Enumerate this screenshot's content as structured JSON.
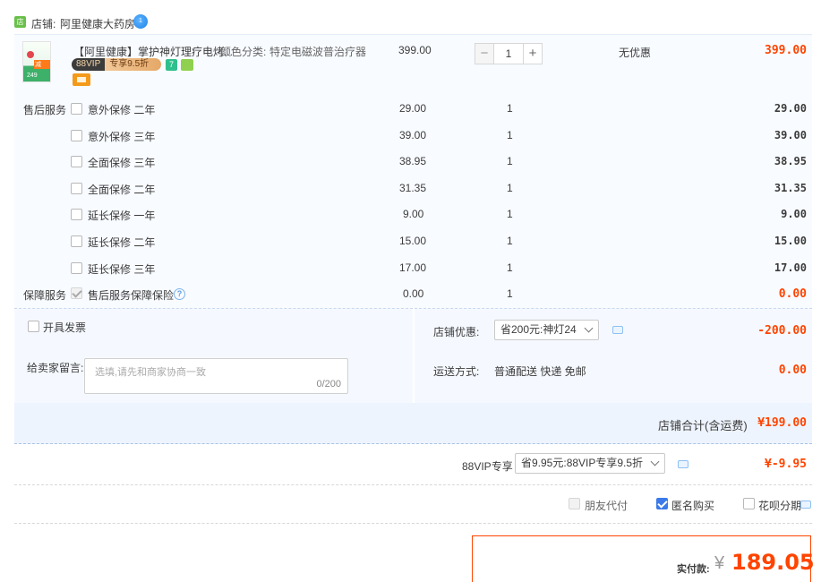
{
  "shop": {
    "icon_text": "店",
    "label": "店铺:",
    "name": "阿里健康大药房",
    "wangwang_text": "1"
  },
  "item": {
    "title": "【阿里健康】掌护神灯理疗电烤...",
    "sku_label": "颜色分类:",
    "sku_value": "特定电磁波普治疗器",
    "unit_price": "399.00",
    "quantity": "1",
    "discount": "无优惠",
    "total": "399.00",
    "vip_badge_left": "88VIP",
    "vip_badge_right": "专享9.5折",
    "tag_seven": "7",
    "thumb_text_top": "减",
    "thumb_text_bottom": "249"
  },
  "after_sales": {
    "section_label": "售后服务",
    "rows": [
      {
        "name": "意外保修 二年",
        "price": "29.00",
        "qty": "1",
        "total": "29.00"
      },
      {
        "name": "意外保修 三年",
        "price": "39.00",
        "qty": "1",
        "total": "39.00"
      },
      {
        "name": "全面保修 三年",
        "price": "38.95",
        "qty": "1",
        "total": "38.95"
      },
      {
        "name": "全面保修 二年",
        "price": "31.35",
        "qty": "1",
        "total": "31.35"
      },
      {
        "name": "延长保修 一年",
        "price": "9.00",
        "qty": "1",
        "total": "9.00"
      },
      {
        "name": "延长保修 二年",
        "price": "15.00",
        "qty": "1",
        "total": "15.00"
      },
      {
        "name": "延长保修 三年",
        "price": "17.00",
        "qty": "1",
        "total": "17.00"
      }
    ]
  },
  "guarantee": {
    "section_label": "保障服务",
    "name": "售后服务保障保险",
    "price": "0.00",
    "qty": "1",
    "total": "0.00",
    "help_glyph": "?"
  },
  "invoice": {
    "label": "开具发票"
  },
  "message": {
    "label": "给卖家留言:",
    "placeholder": "选填,请先和商家协商一致",
    "count": "0/200"
  },
  "shop_discount": {
    "label": "店铺优惠:",
    "selected": "省200元:神灯24",
    "amount": "-200.00"
  },
  "shipping": {
    "label": "运送方式:",
    "value": "普通配送 快递 免邮",
    "amount": "0.00"
  },
  "shop_total": {
    "label": "店铺合计(含运费)",
    "amount": "¥199.00"
  },
  "vip": {
    "label": "88VIP专享",
    "selected": "省9.95元:88VIP专享9.5折",
    "amount": "¥-9.95"
  },
  "options": {
    "friend_pay": "朋友代付",
    "anonymous": "匿名购买",
    "huabei": "花呗分期"
  },
  "payment": {
    "label": "实付款:",
    "currency": "¥",
    "amount": "189.05"
  }
}
